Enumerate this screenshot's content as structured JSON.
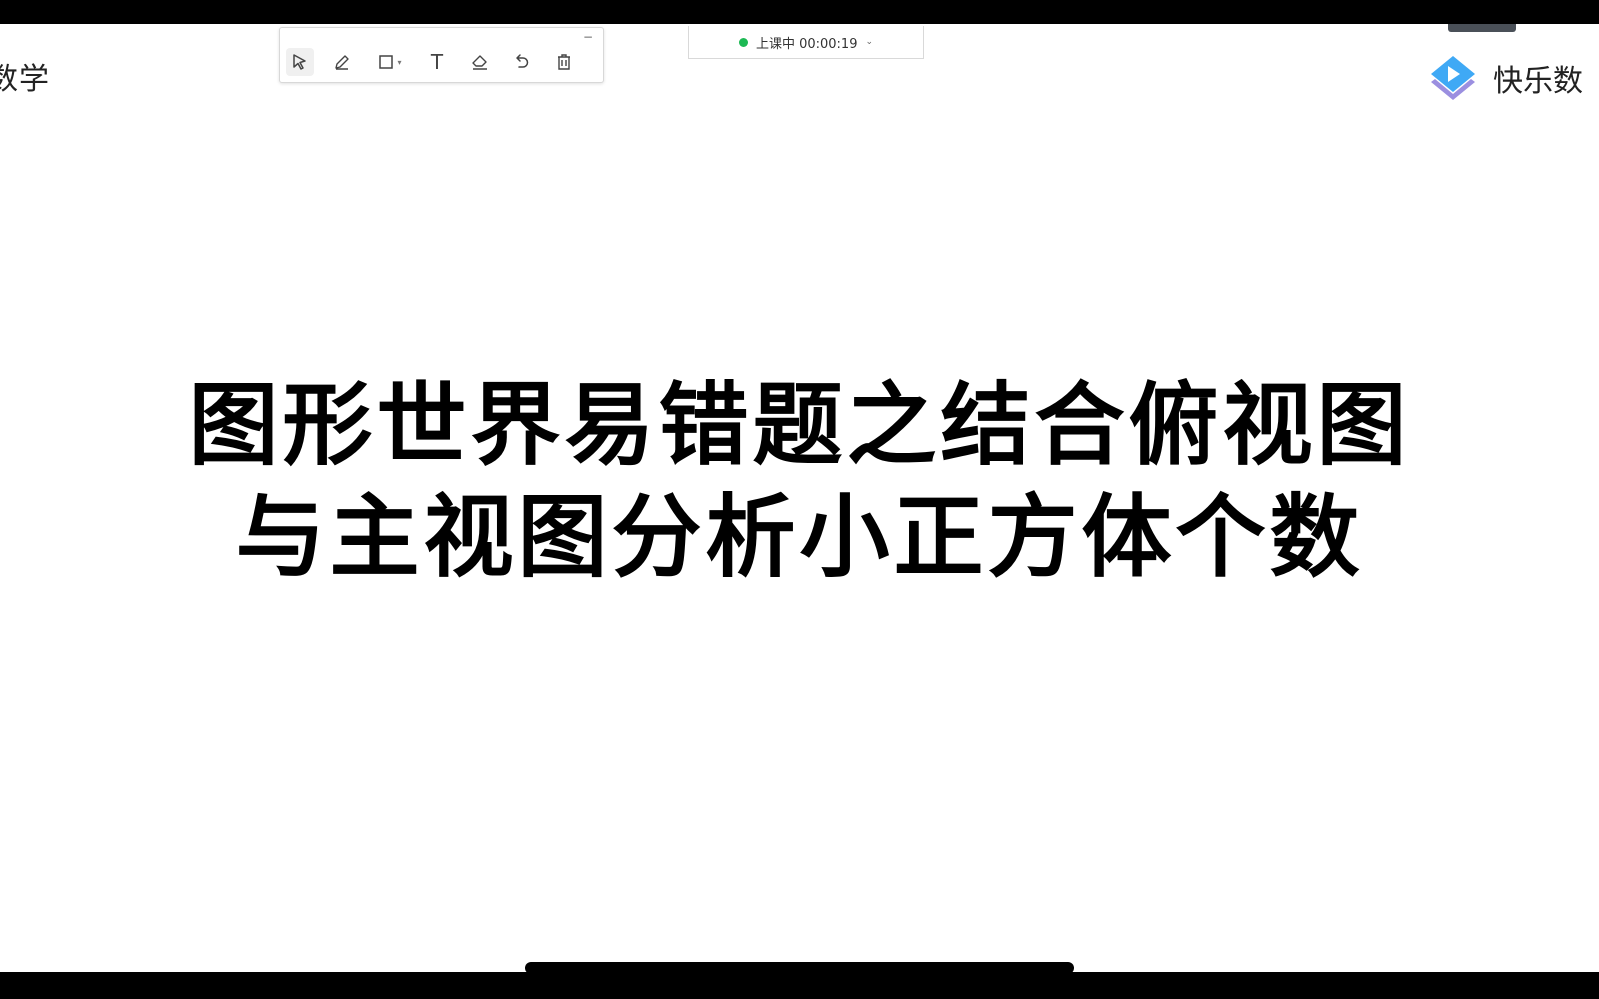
{
  "brand_left": {
    "text": "数学"
  },
  "toolbar": {
    "minimize": "−",
    "tools": [
      {
        "name": "select-tool",
        "icon": "cursor-arrow-icon"
      },
      {
        "name": "pen-tool",
        "icon": "pencil-icon"
      },
      {
        "name": "shape-tool",
        "icon": "rectangle-icon"
      },
      {
        "name": "text-tool",
        "icon": "text-t-icon",
        "glyph": "T"
      },
      {
        "name": "eraser-tool",
        "icon": "eraser-icon"
      },
      {
        "name": "undo-tool",
        "icon": "undo-icon"
      },
      {
        "name": "clear-tool",
        "icon": "trash-icon"
      }
    ]
  },
  "class_status": {
    "text": "上课中 00:00:19",
    "dot_color": "#1db954"
  },
  "brand_right": {
    "name": "快乐数",
    "logo_color": "#3fa9f5"
  },
  "slide": {
    "title_line1": "图形世界易错题之结合俯视图",
    "title_line2": "与主视图分析小正方体个数"
  }
}
